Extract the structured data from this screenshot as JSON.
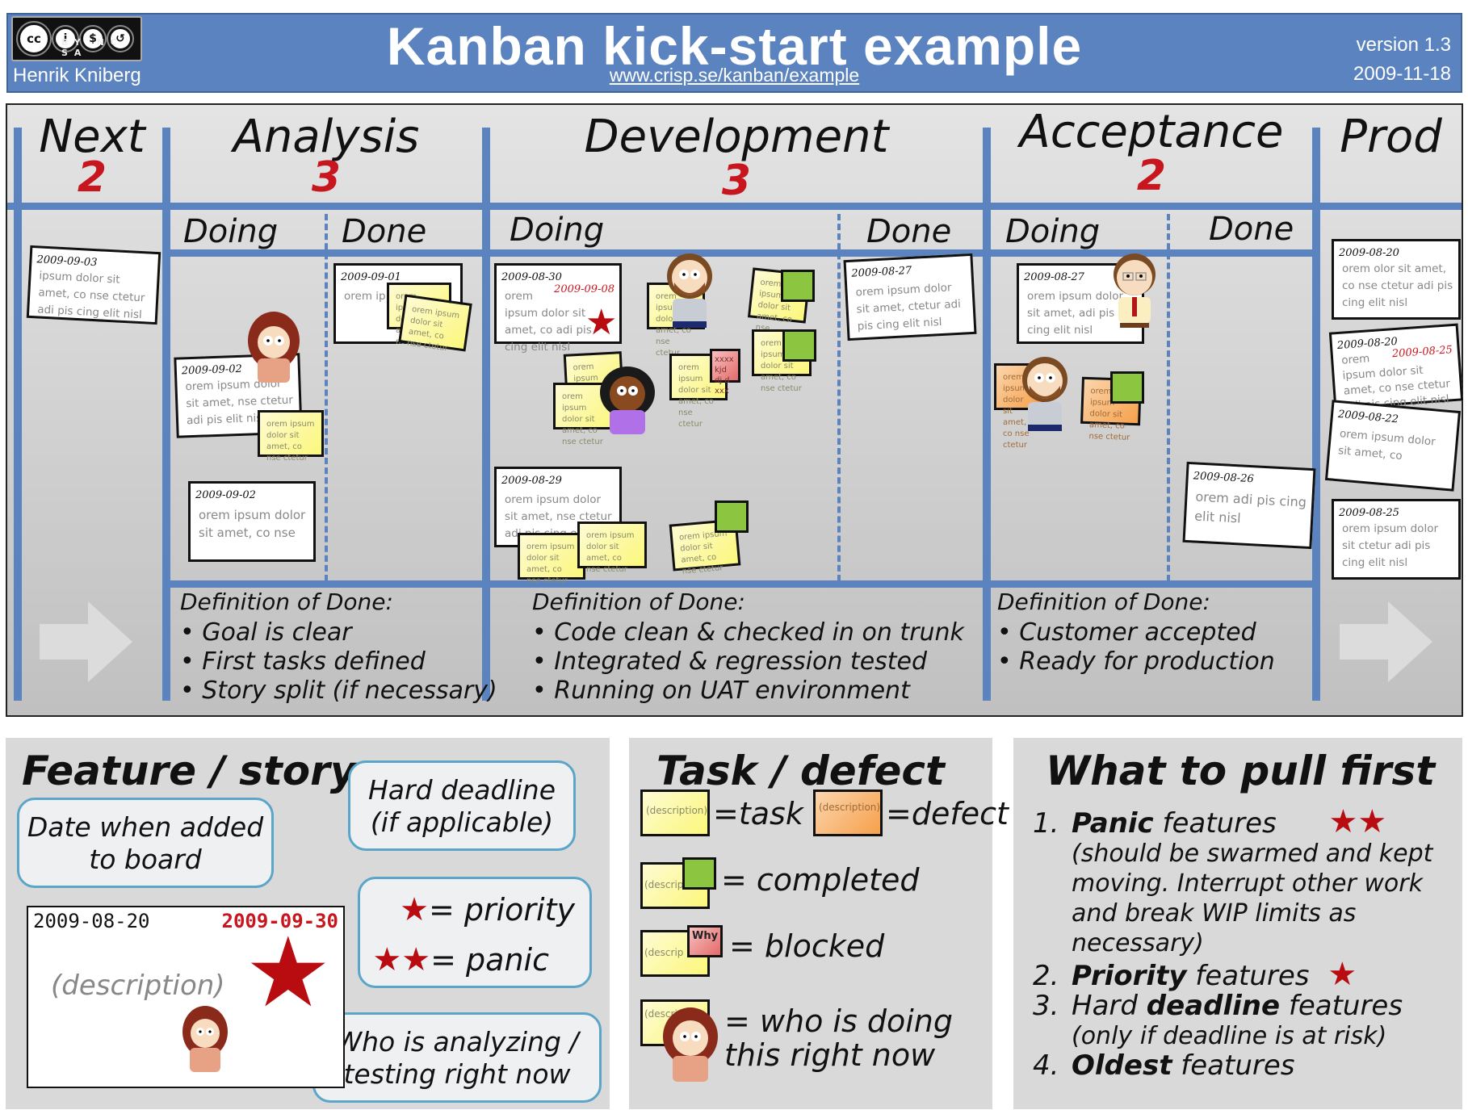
{
  "header": {
    "license_badge": {
      "icons": [
        "cc-icon",
        "by-icon",
        "nc-icon",
        "sa-icon"
      ],
      "labels": "BY NC SA"
    },
    "author": "Henrik Kniberg",
    "title": "Kanban kick-start example",
    "url": "www.crisp.se/kanban/example",
    "version": "version 1.3",
    "date": "2009-11-18"
  },
  "colors": {
    "accent_blue": "#5a83c0",
    "wip_red": "#c8161e",
    "star_red": "#b80c10",
    "task_yellow": "#fbf77a",
    "defect_orange": "#f6a04b",
    "completed_green": "#8cc641",
    "blocked_red": "#e46a6a",
    "bubble_border": "#5ba6c8"
  },
  "board": {
    "columns": [
      {
        "name": "Next",
        "wip": "2"
      },
      {
        "name": "Analysis",
        "wip": "3",
        "sub": [
          "Doing",
          "Done"
        ]
      },
      {
        "name": "Development",
        "wip": "3",
        "sub": [
          "Doing",
          "Done"
        ]
      },
      {
        "name": "Acceptance",
        "wip": "2",
        "sub": [
          "Doing",
          "Done"
        ]
      },
      {
        "name": "Prod"
      }
    ],
    "cards": {
      "next_1": {
        "date": "2009-09-03",
        "text": "ipsum dolor sit amet, co nse ctetur adi pis cing elit nisl"
      },
      "analysis_doing_1": {
        "date": "2009-09-02",
        "text": "orem ipsum dolor sit amet, nse ctetur adi pis elit nisl"
      },
      "analysis_doing_2": {
        "date": "2009-09-02",
        "text": "orem ipsum dolor sit amet, co nse"
      },
      "analysis_done_1": {
        "date": "2009-09-01",
        "text": "orem ipsum dolor sit amet, co adi pis cing"
      },
      "dev_doing_1": {
        "date": "2009-08-30",
        "deadline": "2009-09-08",
        "text": "orem ipsum dolor sit amet, co adi pis cing elit nisl"
      },
      "dev_doing_2": {
        "date": "2009-08-29",
        "text": "orem ipsum dolor sit amet, nse ctetur adi pis cing elit nisl"
      },
      "dev_done_1": {
        "date": "2009-08-27",
        "text": "orem ipsum dolor sit amet, ctetur adi pis cing elit nisl"
      },
      "acc_doing_1": {
        "date": "2009-08-27",
        "text": "orem ipsum dolor sit amet, adi pis cing elit nisl"
      },
      "acc_done_1": {
        "date": "2009-08-26",
        "text": "orem adi pis cing elit nisl"
      },
      "prod_1": {
        "date": "2009-08-20",
        "text": "orem olor sit amet, co nse ctetur adi pis cing elit nisl"
      },
      "prod_2": {
        "date": "2009-08-20",
        "deadline": "2009-08-25",
        "text": "orem ipsum dolor sit amet, co nse ctetur adi pis cing elit nisl"
      },
      "prod_3": {
        "date": "2009-08-22",
        "text": "orem ipsum dolor sit amet, co"
      },
      "prod_4": {
        "date": "2009-08-25",
        "text": "orem ipsum dolor sit ctetur adi pis cing elit nisl"
      }
    },
    "task_text": "orem ipsum dolor sit amet, co nse ctetur",
    "blocked_text": "xxxx kjd dj d xxx",
    "dod": [
      {
        "title": "Definition of Done:",
        "items": [
          "Goal is clear",
          "First tasks defined",
          "Story split (if necessary)"
        ]
      },
      {
        "title": "Definition of Done:",
        "items": [
          "Code clean & checked in on trunk",
          "Integrated & regression tested",
          "Running on UAT environment"
        ]
      },
      {
        "title": "Definition of Done:",
        "items": [
          "Customer accepted",
          "Ready for production"
        ]
      }
    ]
  },
  "legend_feature": {
    "title": "Feature / story",
    "bubble_date": "Date when added to board",
    "bubble_deadline": "Hard deadline (if applicable)",
    "bubble_priority": "= priority",
    "bubble_panic": "= panic",
    "bubble_who": "Who is analyzing / testing right now",
    "card_date": "2009-08-20",
    "card_deadline": "2009-09-30",
    "card_desc": "(description)"
  },
  "legend_task": {
    "title": "Task / defect",
    "desc": "(description)",
    "desc_short": "(descrip",
    "task": "=task",
    "defect": "=defect",
    "completed": "= completed",
    "blocked_label": "Why",
    "blocked": "= blocked",
    "who_line1": "= who is doing",
    "who_line2": "this right now"
  },
  "legend_pull": {
    "title": "What to pull first",
    "items": [
      {
        "num": "1.",
        "bold": "Panic",
        "rest": " features",
        "stars": 2,
        "sub": "(should be swarmed and kept moving. Interrupt other work and break WIP limits as necessary)"
      },
      {
        "num": "2.",
        "bold": "Priority",
        "rest": " features",
        "stars": 1
      },
      {
        "num": "3.",
        "pre": "Hard ",
        "bold": "deadline",
        "rest": " features",
        "sub": "(only if deadline is at risk)"
      },
      {
        "num": "4.",
        "bold": "Oldest",
        "rest": " features"
      }
    ]
  }
}
